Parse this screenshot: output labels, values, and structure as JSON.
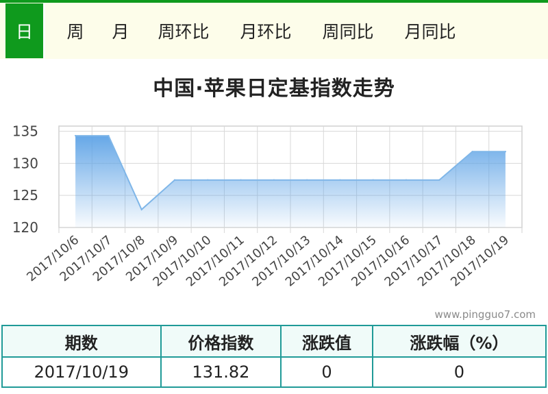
{
  "tabs": [
    {
      "label": "日",
      "active": true
    },
    {
      "label": "周",
      "active": false
    },
    {
      "label": "月",
      "active": false
    },
    {
      "label": "周环比",
      "active": false
    },
    {
      "label": "月环比",
      "active": false
    },
    {
      "label": "周同比",
      "active": false
    },
    {
      "label": "月同比",
      "active": false
    }
  ],
  "watermark": "www.pingguo7.com",
  "colors": {
    "accent": "#0f9a1d",
    "line": "#7fb6e8",
    "fill_top": "#5ea3e6",
    "table_border": "#1f9a97"
  },
  "chart_data": {
    "type": "area",
    "title": "中国·苹果日定基指数走势",
    "categories": [
      "2017/10/6",
      "2017/10/7",
      "2017/10/8",
      "2017/10/9",
      "2017/10/10",
      "2017/10/11",
      "2017/10/12",
      "2017/10/13",
      "2017/10/14",
      "2017/10/15",
      "2017/10/16",
      "2017/10/17",
      "2017/10/18",
      "2017/10/19"
    ],
    "series": [
      {
        "values": [
          134.3,
          134.3,
          122.8,
          127.4,
          127.4,
          127.4,
          127.4,
          127.4,
          127.4,
          127.4,
          127.4,
          127.4,
          131.82,
          131.82
        ]
      }
    ],
    "yticks": [
      120,
      125,
      130,
      135
    ],
    "ylim": [
      120,
      135.8
    ],
    "grid": true,
    "legend": "none"
  },
  "summary": {
    "headers": [
      "期数",
      "价格指数",
      "涨跌值",
      "涨跌幅（%）"
    ],
    "row": [
      "2017/10/19",
      "131.82",
      "0",
      "0"
    ]
  }
}
